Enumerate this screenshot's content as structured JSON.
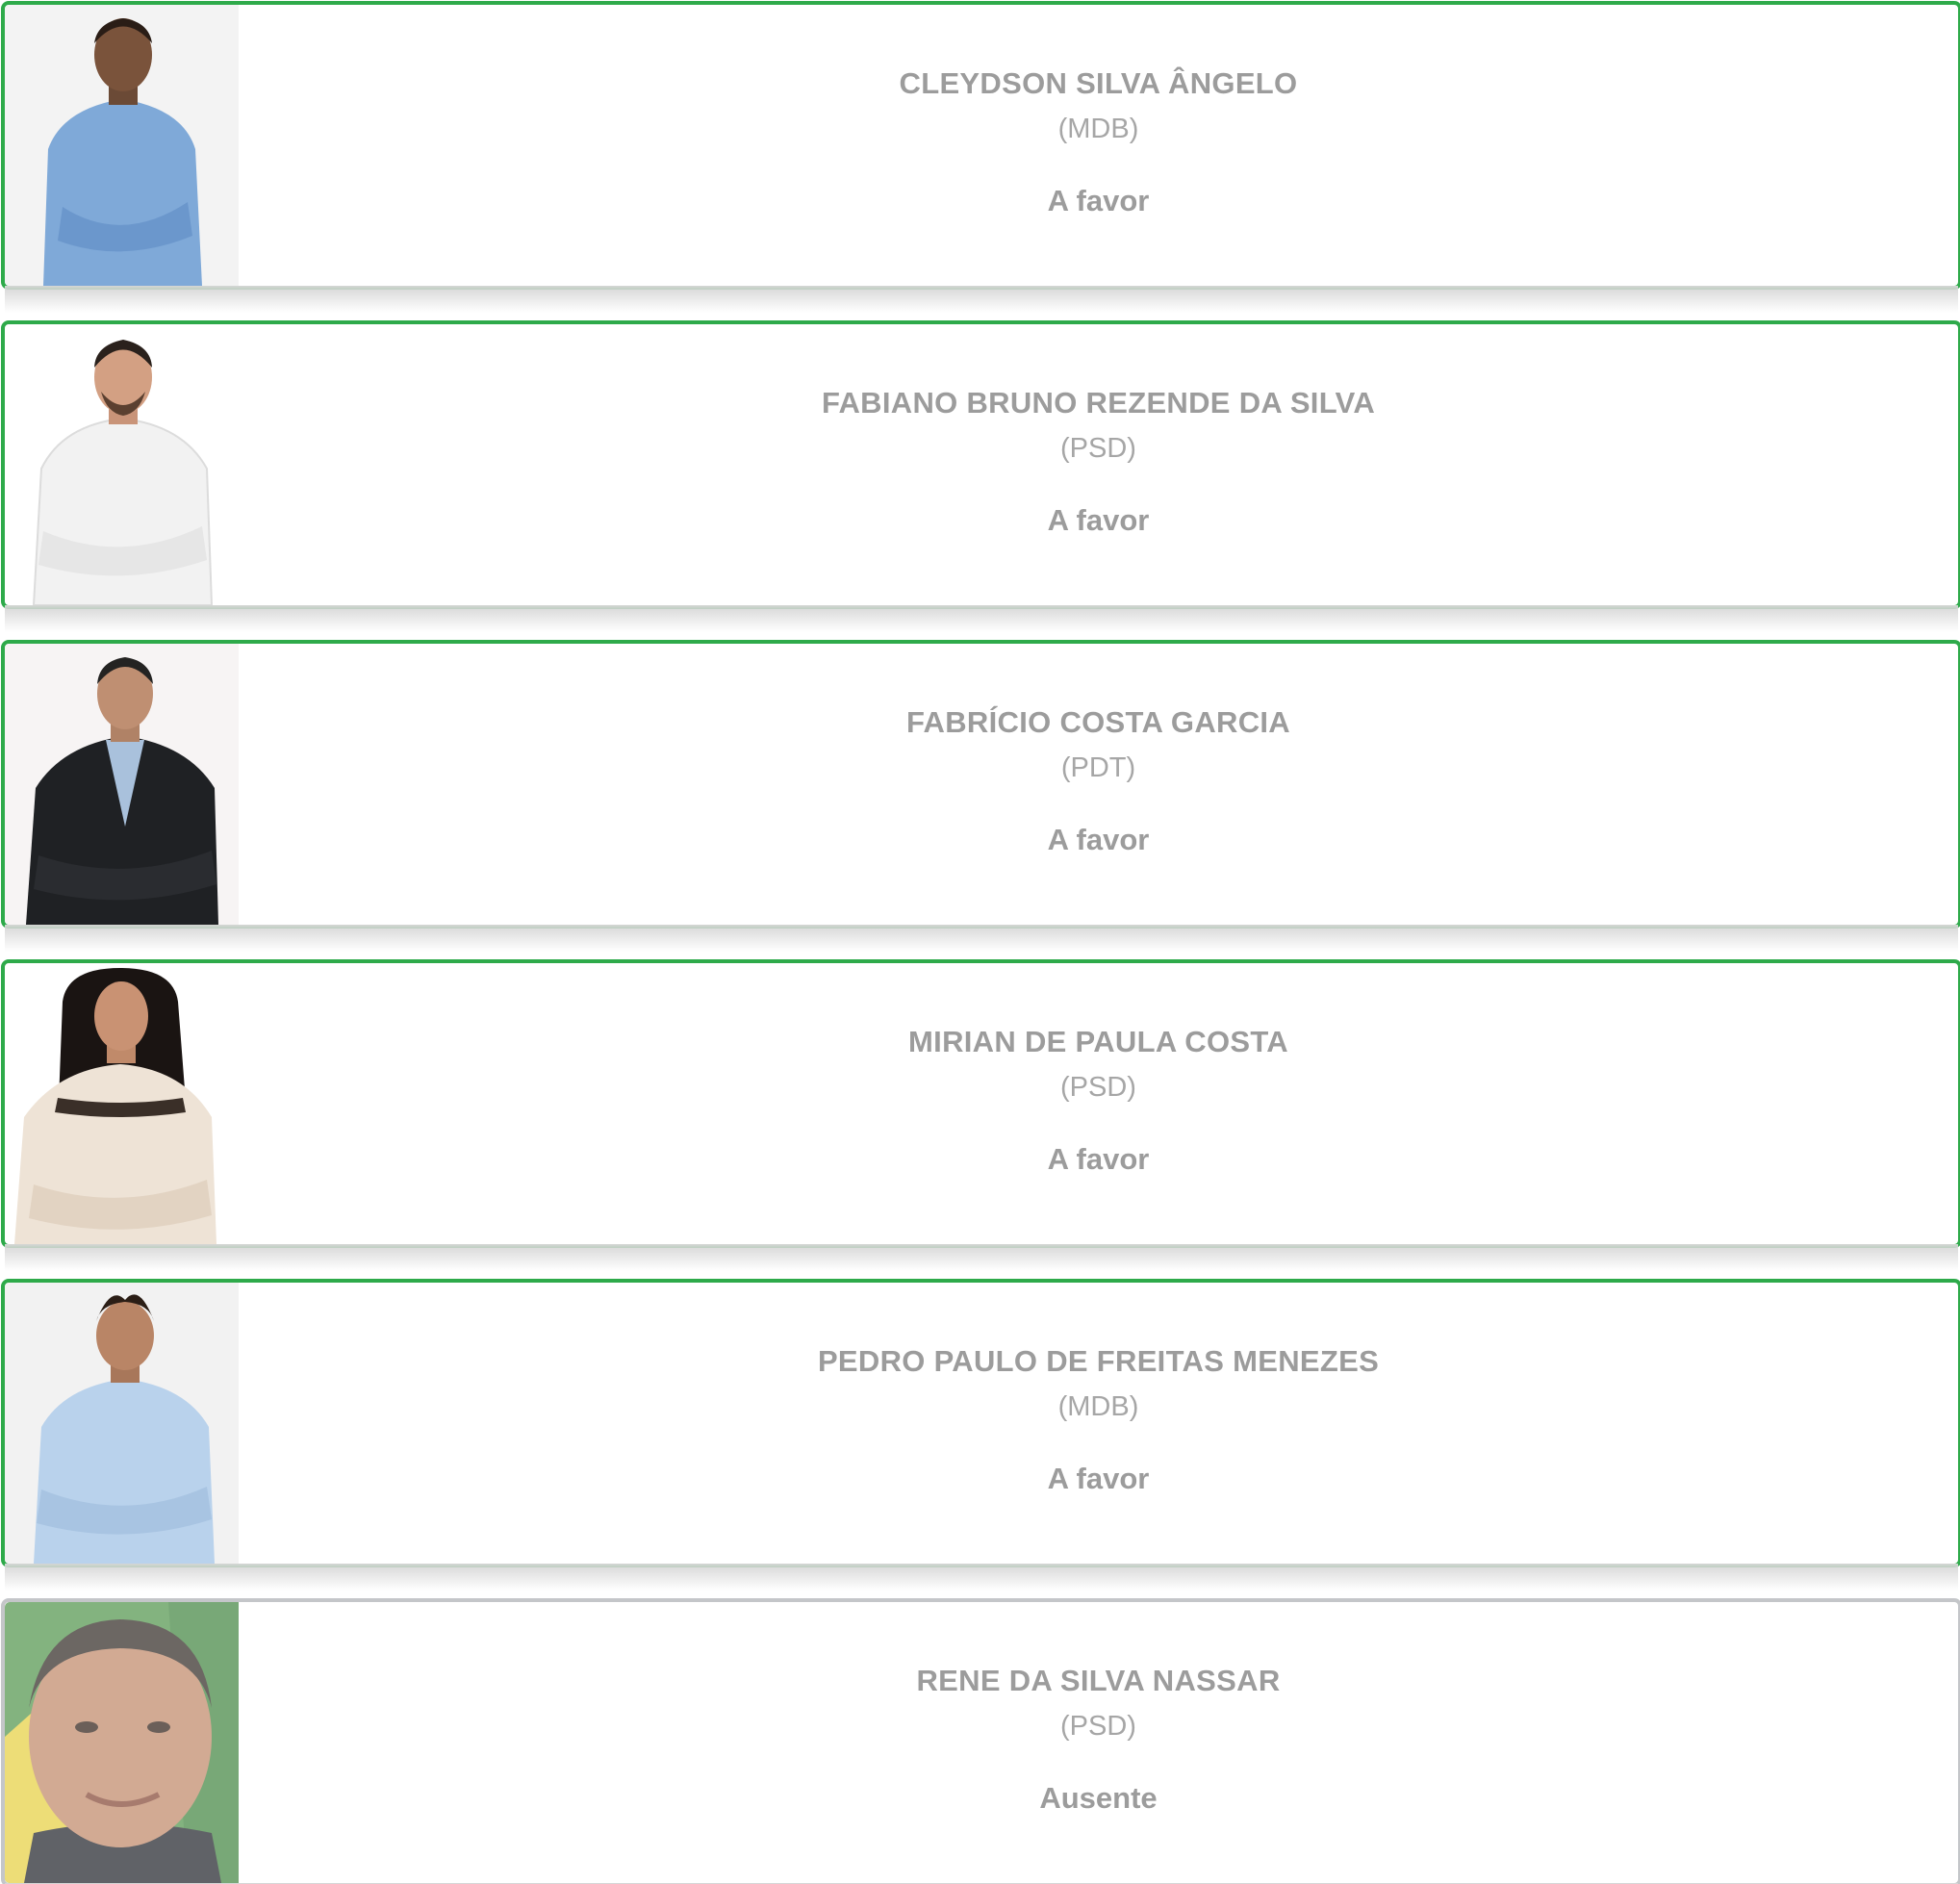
{
  "councilors": [
    {
      "name": "CLEYDSON SILVA ÂNGELO",
      "party": "(MDB)",
      "vote": "A favor",
      "status_color": "#2eaa4a",
      "photo": "portrait-light-blue-shirt"
    },
    {
      "name": "FABIANO BRUNO REZENDE DA SILVA",
      "party": "(PSD)",
      "vote": "A favor",
      "status_color": "#2eaa4a",
      "photo": "portrait-white-shirt"
    },
    {
      "name": "FABRÍCIO COSTA GARCIA",
      "party": "(PDT)",
      "vote": "A favor",
      "status_color": "#2eaa4a",
      "photo": "portrait-black-suit"
    },
    {
      "name": "MIRIAN DE PAULA COSTA",
      "party": "(PSD)",
      "vote": "A favor",
      "status_color": "#2eaa4a",
      "photo": "portrait-lace-blouse"
    },
    {
      "name": "PEDRO PAULO DE FREITAS MENEZES",
      "party": "(MDB)",
      "vote": "A favor",
      "status_color": "#2eaa4a",
      "photo": "portrait-light-blue-shirt"
    },
    {
      "name": "RENE DA SILVA NASSAR",
      "party": "(PSD)",
      "vote": "Ausente",
      "status_color": "#c4c6c9",
      "photo": "portrait-closeup-flag-background"
    }
  ]
}
